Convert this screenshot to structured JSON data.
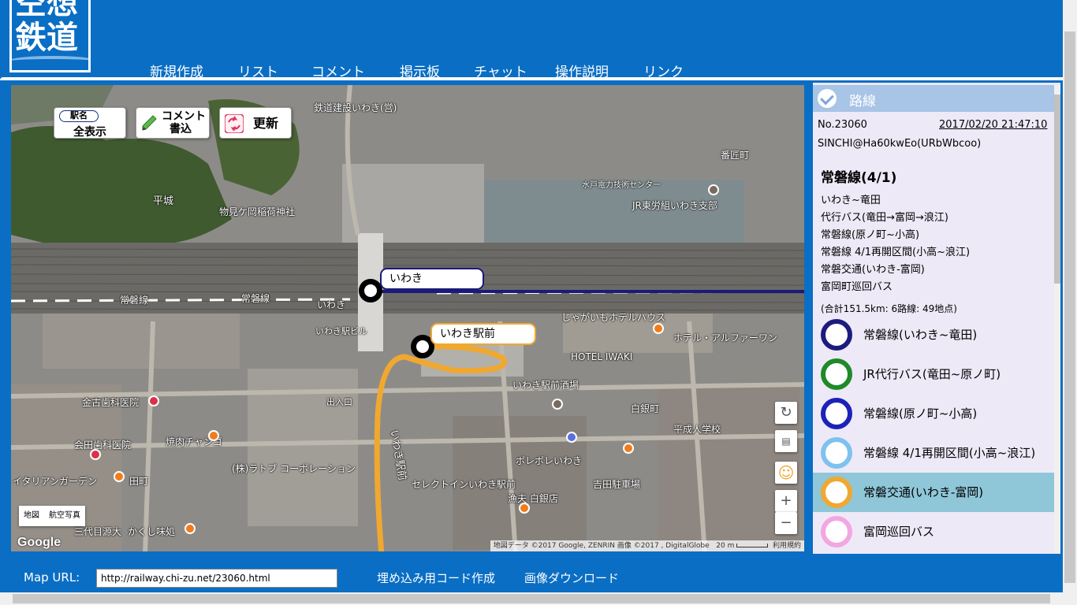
{
  "logo": {
    "line1": "空想",
    "line2": "鉄道"
  },
  "nav": [
    "新規作成",
    "リスト",
    "コメント",
    "掲示板",
    "チャット",
    "操作説明",
    "リンク"
  ],
  "map_tools": {
    "station_small": "駅名",
    "station_big": "全表示",
    "comment_line1": "コメント",
    "comment_line2": "書込",
    "refresh": "更新"
  },
  "map": {
    "stations": [
      {
        "name": "いわき",
        "color": "#1a1a7a"
      },
      {
        "name": "いわき駅前",
        "color": "#f0a830"
      }
    ],
    "labels": [
      "鉄道建設いわき(営)",
      "平城",
      "物見ケ岡稲荷神社",
      "水戸電力技術センター",
      "JR東労組いわき支部",
      "番匠町",
      "常磐線",
      "常磐線",
      "いわき",
      "いわき駅ビル",
      "じゃがいもホテルハウス",
      "ホテル・アルファーワン",
      "HOTEL IWAKI",
      "いわき駅前酒場",
      "白銀町",
      "平成人学校",
      "金古歯科医院",
      "焼肉チャンゴ",
      "会田歯科医院",
      "(株)ラトブ コーポレーション",
      "セレクトインいわき駅前",
      "ボレボレいわき",
      "吉田駐車場",
      "イタリアンガーデン",
      "田町",
      "三代目源大",
      "かくし味処",
      "漁夫 白銀店",
      "出入口",
      "いわき駅前"
    ],
    "map_type_buttons": [
      "地図",
      "航空写真"
    ],
    "google": "Google",
    "attribution": "地図データ ©2017 Google, ZENRIN 画像 ©2017 , DigitalGlobe",
    "scale": "20 m",
    "terms": "利用規約",
    "zoom_in": "+",
    "zoom_out": "−"
  },
  "panel": {
    "title": "路線",
    "number": "No.23060",
    "datetime": "2017/02/20 21:47:10",
    "author": "SINCHI@Ha60kwEo(URbWbcoo)",
    "route_title": "常磐線(4/1)",
    "description_lines": [
      "いわき~竜田",
      "代行バス(竜田→富岡→浪江)",
      "常磐線(原ノ町~小高)",
      "常磐線 4/1再開区間(小高~浪江)",
      "常磐交通(いわき-富岡)",
      "富岡町巡回バス"
    ],
    "summary": "(合計151.5km: 6路線: 49地点)",
    "routes": [
      {
        "name": "常磐線(いわき~竜田)",
        "color": "#1c1c7e",
        "selected": false
      },
      {
        "name": "JR代行バス(竜田~原ノ町)",
        "color": "#1e8a2a",
        "selected": false
      },
      {
        "name": "常磐線(原ノ町~小高)",
        "color": "#1c22b8",
        "selected": false
      },
      {
        "name": "常磐線 4/1再開区間(小高~浪江)",
        "color": "#7ec2ef",
        "selected": false
      },
      {
        "name": "常磐交通(いわき-富岡)",
        "color": "#f0a830",
        "selected": true
      },
      {
        "name": "富岡巡回バス",
        "color": "#f2a6e2",
        "selected": false
      }
    ]
  },
  "footer": {
    "map_url_label": "Map URL:",
    "map_url_value": "http://railway.chi-zu.net/23060.html",
    "embed_link": "埋め込み用コード作成",
    "download_link": "画像ダウンロード"
  }
}
